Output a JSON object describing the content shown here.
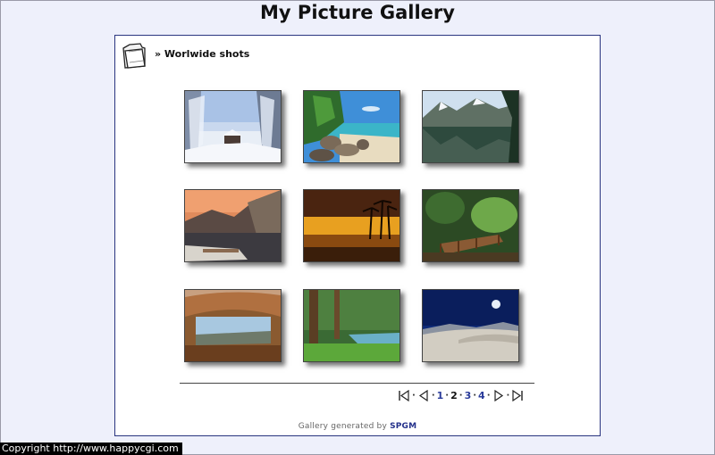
{
  "page": {
    "title": "My Picture Gallery"
  },
  "breadcrumb": {
    "text": "» Worlwide shots",
    "icon": "folder-icon"
  },
  "gallery": {
    "thumbnails": [
      {
        "name": "thumb-winter-cabin"
      },
      {
        "name": "thumb-tropical-beach"
      },
      {
        "name": "thumb-mountain-lake"
      },
      {
        "name": "thumb-sunset-mountains"
      },
      {
        "name": "thumb-palm-sunset"
      },
      {
        "name": "thumb-forest-bridge"
      },
      {
        "name": "thumb-rock-arch"
      },
      {
        "name": "thumb-forest-river"
      },
      {
        "name": "thumb-moon-dunes"
      }
    ]
  },
  "pagination": {
    "pages": [
      "1",
      "2",
      "3",
      "4"
    ],
    "current": "2",
    "first_icon": "first-page-icon",
    "prev_icon": "previous-page-icon",
    "next_icon": "next-page-icon",
    "last_icon": "last-page-icon"
  },
  "footer": {
    "prefix": "Gallery generated by",
    "brand": "SPGM"
  },
  "copyright": {
    "text": "Copyright   http://www.happycgi.com"
  }
}
